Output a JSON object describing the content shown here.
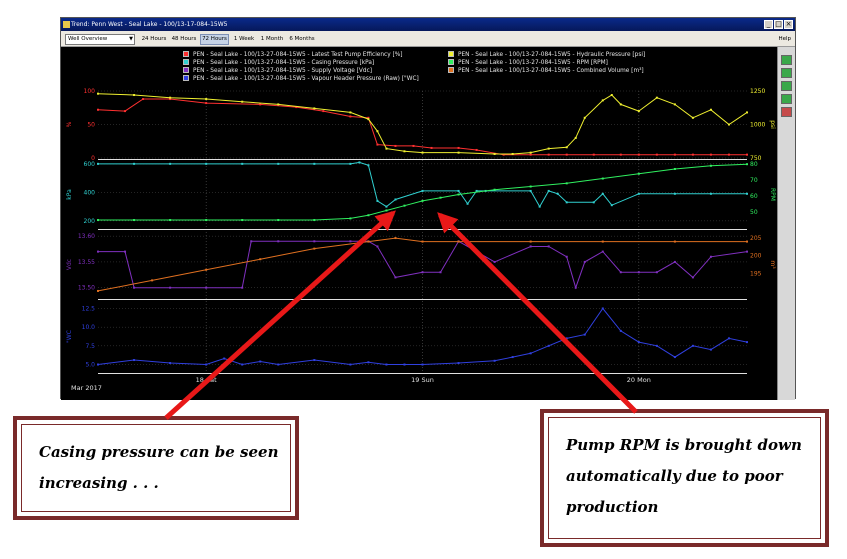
{
  "window": {
    "title": "Trend: Penn West - Seal Lake - 100/13-17-084-15W5",
    "view_select": "Well Overview",
    "time_buttons": [
      "24 Hours",
      "48 Hours",
      "72 Hours",
      "1 Week",
      "1 Month",
      "6 Months"
    ],
    "selected_range": "72 Hours",
    "help_label": "Help"
  },
  "legend": [
    {
      "label": "PEN - Seal Lake - 100/13-27-084-15W5 - Latest Test Pump Efficiency  [%]",
      "color": "#ff3030"
    },
    {
      "label": "PEN - Seal Lake - 100/13-27-084-15W5 - Casing Pressure  [kPa]",
      "color": "#30d0d0"
    },
    {
      "label": "PEN - Seal Lake - 100/13-27-084-15W5 - Supply Voltage  [Vdc]",
      "color": "#8030c0"
    },
    {
      "label": "PEN - Seal Lake - 100/13-27-084-15W5 - Vapour Header Pressure (Raw)  [\"WC]",
      "color": "#3040e0"
    },
    {
      "label": "PEN - Seal Lake - 100/13-27-084-15W5 - Hydraulic Pressure  [psi]",
      "color": "#f0f030"
    },
    {
      "label": "PEN - Seal Lake - 100/13-27-084-15W5 - RPM  [RPM]",
      "color": "#30f060"
    },
    {
      "label": "PEN - Seal Lake - 100/13-27-084-15W5 - Combined Volume  [m³]",
      "color": "#e07020"
    }
  ],
  "axes": {
    "panel1_left": {
      "unit": "%",
      "ticks": [
        "100",
        "50",
        "0"
      ]
    },
    "panel1_right": {
      "unit": "psi",
      "ticks": [
        "1250",
        "1000",
        "750"
      ]
    },
    "panel2_left": {
      "unit": "kPa",
      "ticks": [
        "600",
        "400",
        "200"
      ]
    },
    "panel2_right": {
      "unit": "RPM",
      "ticks": [
        "80",
        "70",
        "60",
        "50"
      ]
    },
    "panel3_left": {
      "unit": "Vdc",
      "ticks": [
        "13.60",
        "13.55",
        "13.50"
      ]
    },
    "panel3_right": {
      "unit": "m³",
      "ticks": [
        "205",
        "200",
        "195"
      ]
    },
    "panel4_left": {
      "unit": "\"WC",
      "ticks": [
        "12.5",
        "10.0",
        "7.5",
        "5.0"
      ]
    },
    "x_ticks": [
      "18 Sat",
      "19 Sun",
      "20 Mon"
    ],
    "x_start": "Mar 2017"
  },
  "chart_data": {
    "type": "line",
    "x_range_hours": [
      0,
      72
    ],
    "panels": [
      {
        "series": [
          {
            "name": "Latest Test Pump Efficiency",
            "unit": "%",
            "x": [
              0,
              3,
              5,
              8,
              12,
              18,
              22,
              25,
              28,
              30,
              31,
              33,
              35,
              37,
              40,
              42,
              45,
              48,
              50,
              52,
              55,
              58,
              60,
              62,
              64,
              66,
              68,
              70,
              72
            ],
            "y": [
              72,
              70,
              88,
              88,
              82,
              80,
              76,
              70,
              62,
              60,
              20,
              18,
              18,
              15,
              15,
              12,
              5,
              5,
              5,
              5,
              5,
              5,
              5,
              5,
              5,
              5,
              5,
              5,
              5
            ]
          },
          {
            "name": "Hydraulic Pressure",
            "unit": "psi",
            "x": [
              0,
              4,
              8,
              12,
              16,
              20,
              24,
              28,
              30,
              31,
              32,
              34,
              36,
              40,
              44,
              46,
              48,
              50,
              52,
              53,
              54,
              56,
              57,
              58,
              60,
              62,
              64,
              66,
              68,
              70,
              72
            ],
            "y": [
              1230,
              1220,
              1200,
              1190,
              1170,
              1150,
              1120,
              1090,
              1040,
              950,
              820,
              800,
              790,
              790,
              780,
              780,
              790,
              820,
              830,
              900,
              1050,
              1180,
              1220,
              1150,
              1100,
              1200,
              1150,
              1050,
              1110,
              1000,
              1090
            ]
          }
        ]
      },
      {
        "series": [
          {
            "name": "Casing Pressure",
            "unit": "kPa",
            "x": [
              0,
              4,
              8,
              12,
              16,
              20,
              24,
              28,
              29,
              30,
              31,
              32,
              33,
              36,
              40,
              41,
              42,
              43,
              48,
              49,
              50,
              51,
              52,
              55,
              56,
              57,
              60,
              64,
              68,
              72
            ],
            "y": [
              600,
              600,
              600,
              600,
              600,
              600,
              600,
              600,
              610,
              590,
              340,
              300,
              350,
              410,
              410,
              320,
              410,
              410,
              410,
              300,
              410,
              390,
              330,
              330,
              390,
              310,
              390,
              390,
              390,
              390
            ]
          },
          {
            "name": "RPM",
            "unit": "RPM",
            "x": [
              0,
              4,
              8,
              12,
              16,
              20,
              24,
              28,
              30,
              32,
              34,
              36,
              38,
              40,
              44,
              48,
              52,
              56,
              60,
              64,
              68,
              72
            ],
            "y": [
              45,
              45,
              45,
              45,
              45,
              45,
              45,
              46,
              48,
              51,
              54,
              57,
              59,
              61,
              64,
              66,
              68,
              71,
              74,
              77,
              79,
              80
            ]
          }
        ]
      },
      {
        "series": [
          {
            "name": "Supply Voltage",
            "unit": "Vdc",
            "x": [
              0,
              3,
              4,
              8,
              12,
              16,
              17,
              20,
              24,
              28,
              30,
              31,
              33,
              36,
              38,
              40,
              42,
              44,
              48,
              50,
              52,
              53,
              54,
              56,
              58,
              60,
              62,
              64,
              66,
              68,
              72
            ],
            "y": [
              13.57,
              13.57,
              13.5,
              13.5,
              13.5,
              13.5,
              13.59,
              13.59,
              13.59,
              13.59,
              13.59,
              13.58,
              13.52,
              13.53,
              13.53,
              13.59,
              13.57,
              13.55,
              13.58,
              13.58,
              13.56,
              13.5,
              13.55,
              13.57,
              13.53,
              13.53,
              13.53,
              13.55,
              13.52,
              13.56,
              13.57
            ]
          },
          {
            "name": "Combined Volume",
            "unit": "m³",
            "x": [
              0,
              6,
              12,
              18,
              24,
              30,
              33,
              36,
              40,
              48,
              56,
              64,
              72
            ],
            "y": [
              190,
              193,
              196,
              199,
              202,
              204,
              205,
              204,
              204,
              204,
              204,
              204,
              204
            ]
          }
        ]
      },
      {
        "series": [
          {
            "name": "Vapour Header Pressure (Raw)",
            "unit": "\"WC",
            "x": [
              0,
              4,
              8,
              12,
              14,
              16,
              18,
              20,
              24,
              28,
              30,
              32,
              34,
              36,
              40,
              44,
              46,
              48,
              50,
              52,
              54,
              56,
              58,
              60,
              62,
              64,
              66,
              68,
              70,
              72
            ],
            "y": [
              5.0,
              5.6,
              5.2,
              5.0,
              5.8,
              5.0,
              5.4,
              5.0,
              5.6,
              5.0,
              5.3,
              5.0,
              5.0,
              5.0,
              5.2,
              5.5,
              6.0,
              6.5,
              7.5,
              8.5,
              9.0,
              12.5,
              9.5,
              8.0,
              7.5,
              6.0,
              7.5,
              7.0,
              8.5,
              8.0
            ]
          }
        ]
      }
    ]
  },
  "annotations": {
    "left_note": [
      "Casing pressure can be seen",
      "increasing . . ."
    ],
    "right_note": [
      "Pump RPM is brought down",
      "automatically due to poor",
      "production"
    ]
  }
}
